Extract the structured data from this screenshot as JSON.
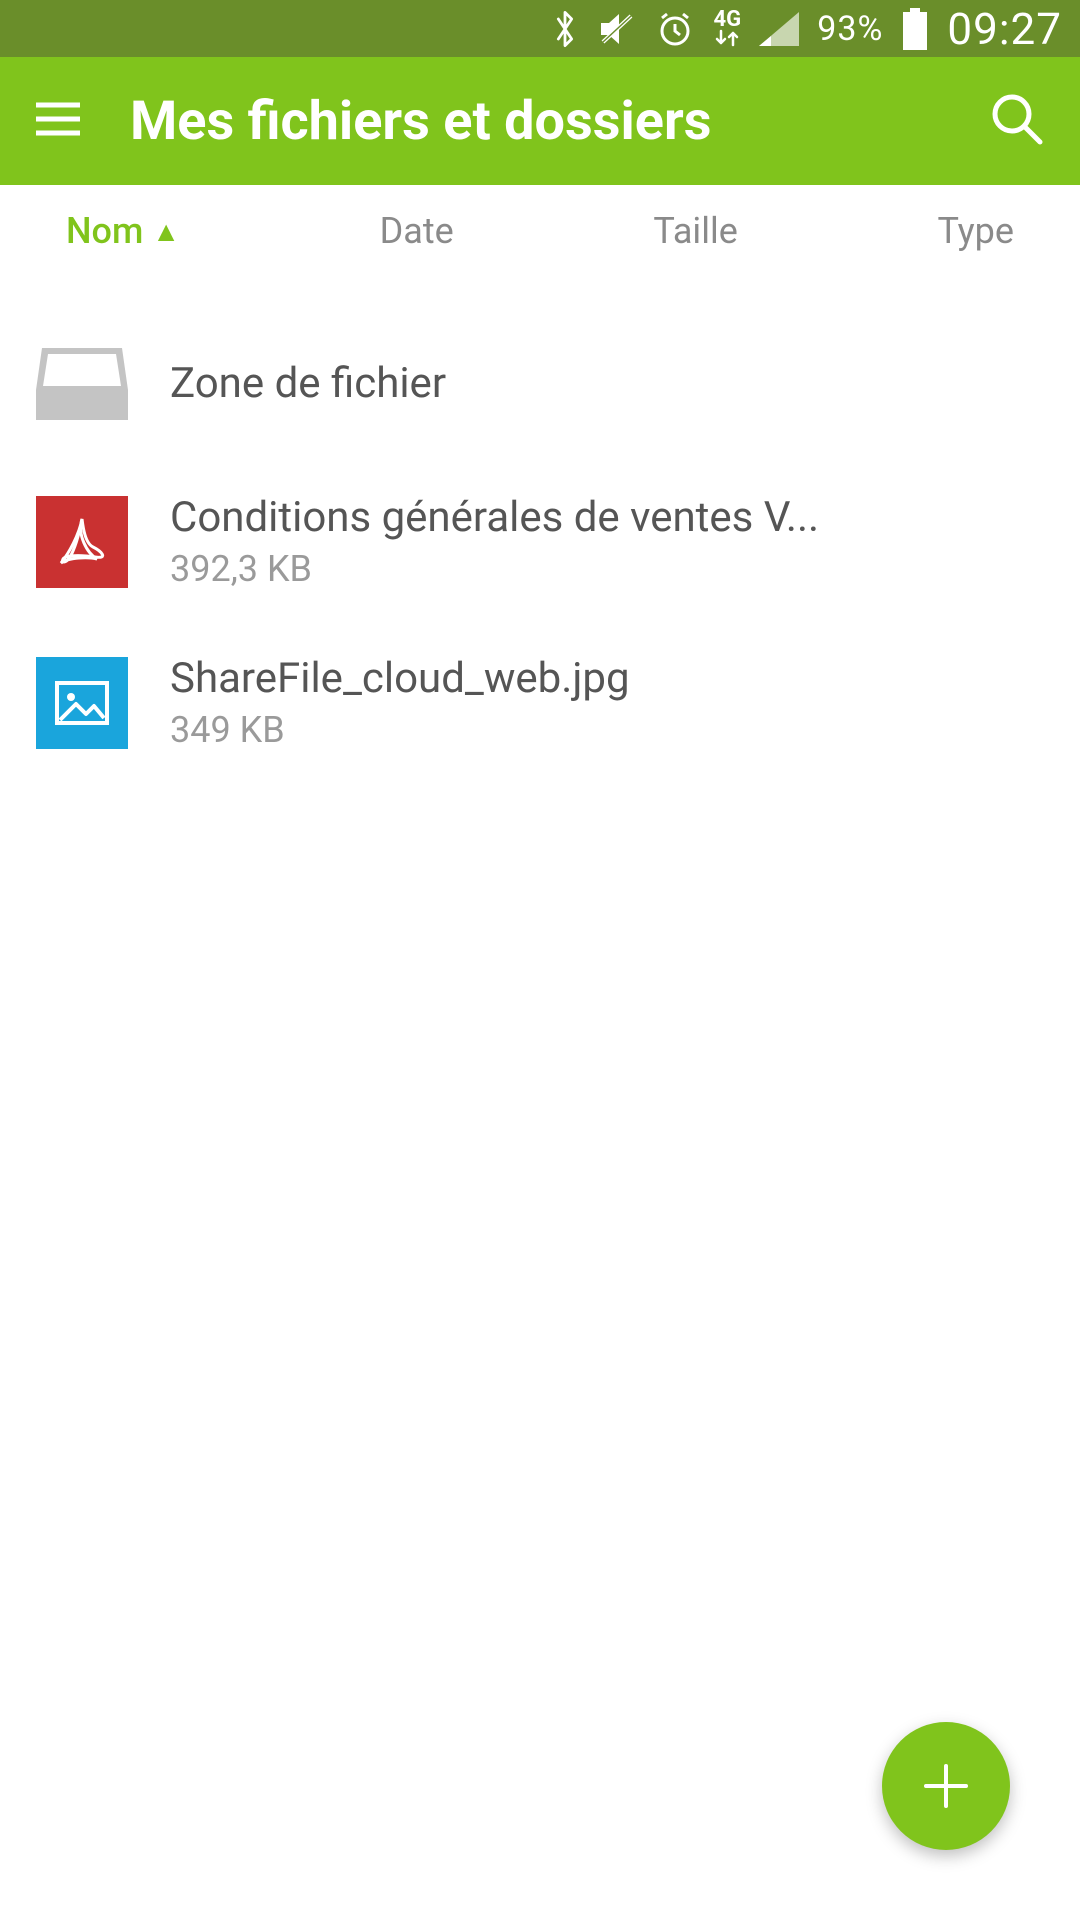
{
  "status": {
    "network_label": "4G",
    "battery_pct": "93%",
    "time": "09:27"
  },
  "header": {
    "title": "Mes fichiers et dossiers"
  },
  "sort": {
    "name": "Nom",
    "arrow": "▲",
    "date": "Date",
    "size": "Taille",
    "type": "Type"
  },
  "items": [
    {
      "name": "Zone de fichier",
      "meta": ""
    },
    {
      "name": "Conditions générales de ventes V...",
      "meta": "392,3 KB"
    },
    {
      "name": "ShareFile_cloud_web.jpg",
      "meta": "349 KB"
    }
  ]
}
